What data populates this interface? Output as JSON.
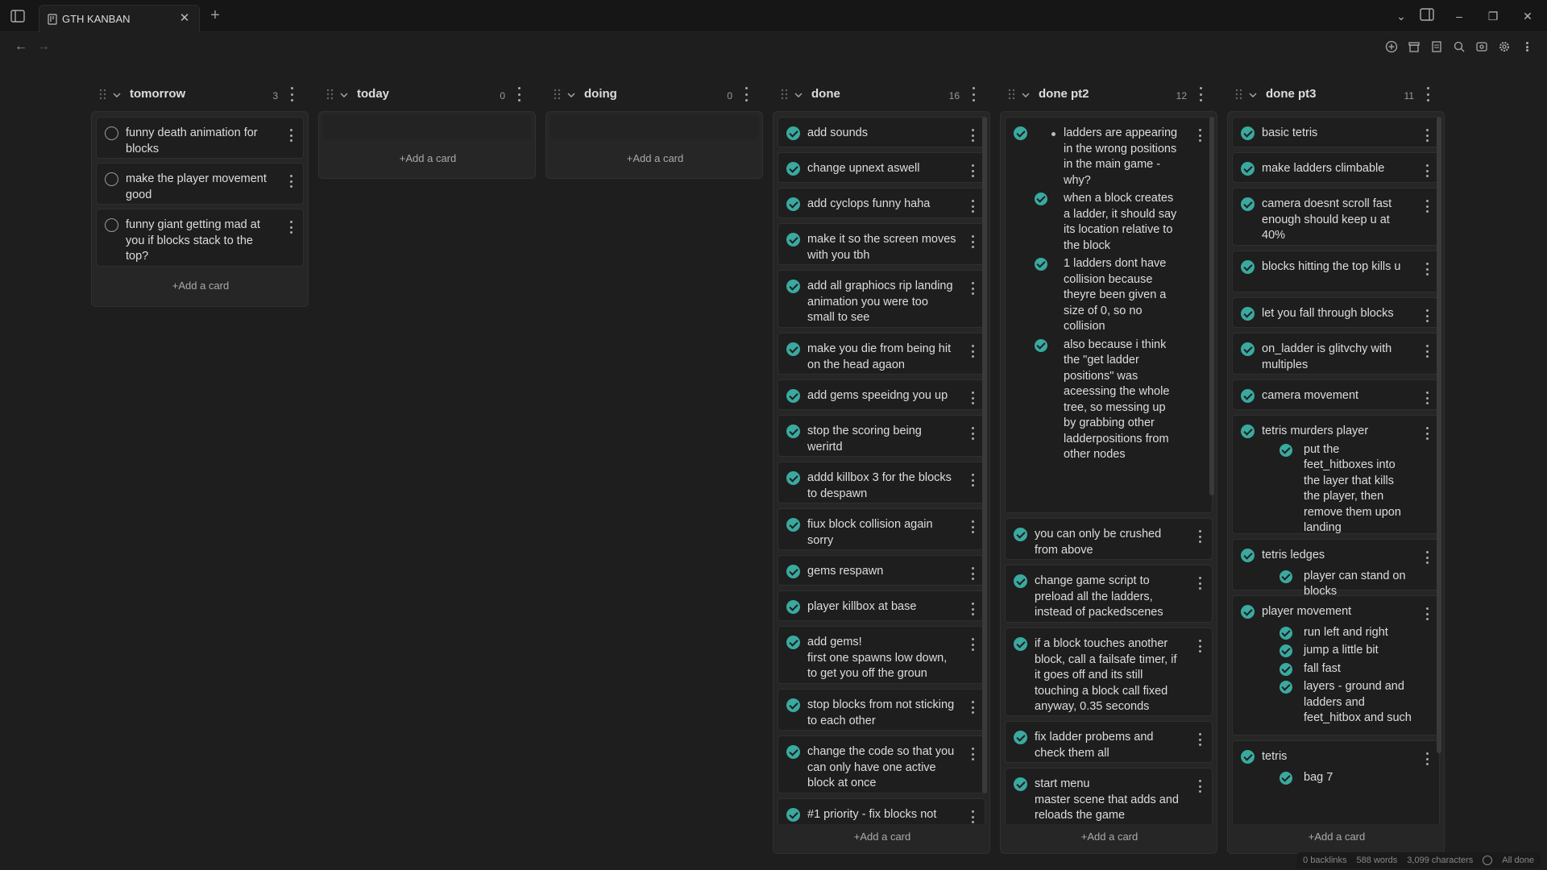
{
  "tab": {
    "title": "GTH KANBAN"
  },
  "statusbar": {
    "backlinks": "0 backlinks",
    "words": "588 words",
    "characters": "3,099 characters",
    "sync": "All done"
  },
  "add_card_label": "+Add a card",
  "lanes": [
    {
      "title": "tomorrow",
      "count": "3",
      "cards": [
        {
          "text": "funny death animation for blocks",
          "done": false
        },
        {
          "text": "make the player movement good",
          "done": false
        },
        {
          "text": "funny giant getting mad at you if blocks stack to the top?",
          "done": false
        }
      ]
    },
    {
      "title": "today",
      "count": "0",
      "cards": []
    },
    {
      "title": "doing",
      "count": "0",
      "cards": []
    },
    {
      "title": "done",
      "count": "16",
      "cards": [
        {
          "text": "add sounds",
          "done": true
        },
        {
          "text": "change upnext aswell",
          "done": true
        },
        {
          "text": "add cyclops funny haha",
          "done": true
        },
        {
          "text": "make it so the screen moves with you tbh",
          "done": true
        },
        {
          "text": "add all graphiocs rip landing animation you were too small to see",
          "done": true
        },
        {
          "text": "make you die from being hit on the head agaon",
          "done": true
        },
        {
          "text": "add gems speeidng you up",
          "done": true
        },
        {
          "text": "stop the scoring being werirtd",
          "done": true
        },
        {
          "text": "addd killbox 3 for the blocks to despawn",
          "done": true
        },
        {
          "text": "fiux block collision again sorry",
          "done": true
        },
        {
          "text": "gems respawn",
          "done": true
        },
        {
          "text": "player killbox at base",
          "done": true
        },
        {
          "text": "add gems!",
          "text2": "first one spawns low down, to get you off the groun",
          "done": true
        },
        {
          "text": "stop blocks from not sticking to each other",
          "done": true
        },
        {
          "text": "change the code so that you can only have one active block at once",
          "done": true
        },
        {
          "text": "#1 priority - fix blocks not",
          "done": true
        }
      ]
    },
    {
      "title": "done pt2",
      "count": "12",
      "cards": [
        {
          "done": true,
          "bullet": "ladders are appearing in the wrong positions in the main game - why?",
          "subs": [
            "when a block creates a ladder, it should say its location relative to the block",
            "1 ladders dont have collision because theyre been given a size of 0, so no collision",
            "also because i think the \"get ladder positions\" was aceessing the whole tree, so messing up by grabbing other ladderpositions from other nodes"
          ]
        },
        {
          "text": "you can only be crushed from above",
          "done": true
        },
        {
          "text": "change game script to preload all the ladders, instead of packedscenes",
          "done": true
        },
        {
          "text": "if a block touches another block, call a failsafe timer, if it goes off and its still touching a block call fixed anyway, 0.35 seconds",
          "done": true
        },
        {
          "text": "fix ladder probems and check them all",
          "done": true
        },
        {
          "text": "start menu",
          "text2": "master scene that adds and reloads the game",
          "done": true
        }
      ]
    },
    {
      "title": "done pt3",
      "count": "11",
      "cards": [
        {
          "text": "basic tetris",
          "done": true
        },
        {
          "text": "make ladders climbable",
          "done": true
        },
        {
          "text": "camera doesnt scroll fast enough should keep u at 40%",
          "done": true
        },
        {
          "text": "blocks hitting the top kills u",
          "done": true
        },
        {
          "text": "let you fall through blocks",
          "done": true
        },
        {
          "text": "on_ladder is glitvchy with multiples",
          "done": true
        },
        {
          "text": "camera movement",
          "done": true
        },
        {
          "text": "tetris murders player",
          "subs": [
            "put the feet_hitboxes into the layer that kills the player, then remove them upon landing"
          ],
          "done": true
        },
        {
          "text": "tetris ledges",
          "subs": [
            "player can stand on blocks"
          ],
          "done": true
        },
        {
          "text": "player movement",
          "subs": [
            "run left and right",
            "jump a little bit",
            "fall fast",
            "layers - ground and ladders and feet_hitbox and such"
          ],
          "done": true
        },
        {
          "text": "tetris",
          "subs": [
            "bag 7"
          ],
          "done": true
        }
      ]
    }
  ],
  "colors": {
    "accent": "#3aa99f",
    "background": "#1e1e1e",
    "lane": "#262626"
  }
}
